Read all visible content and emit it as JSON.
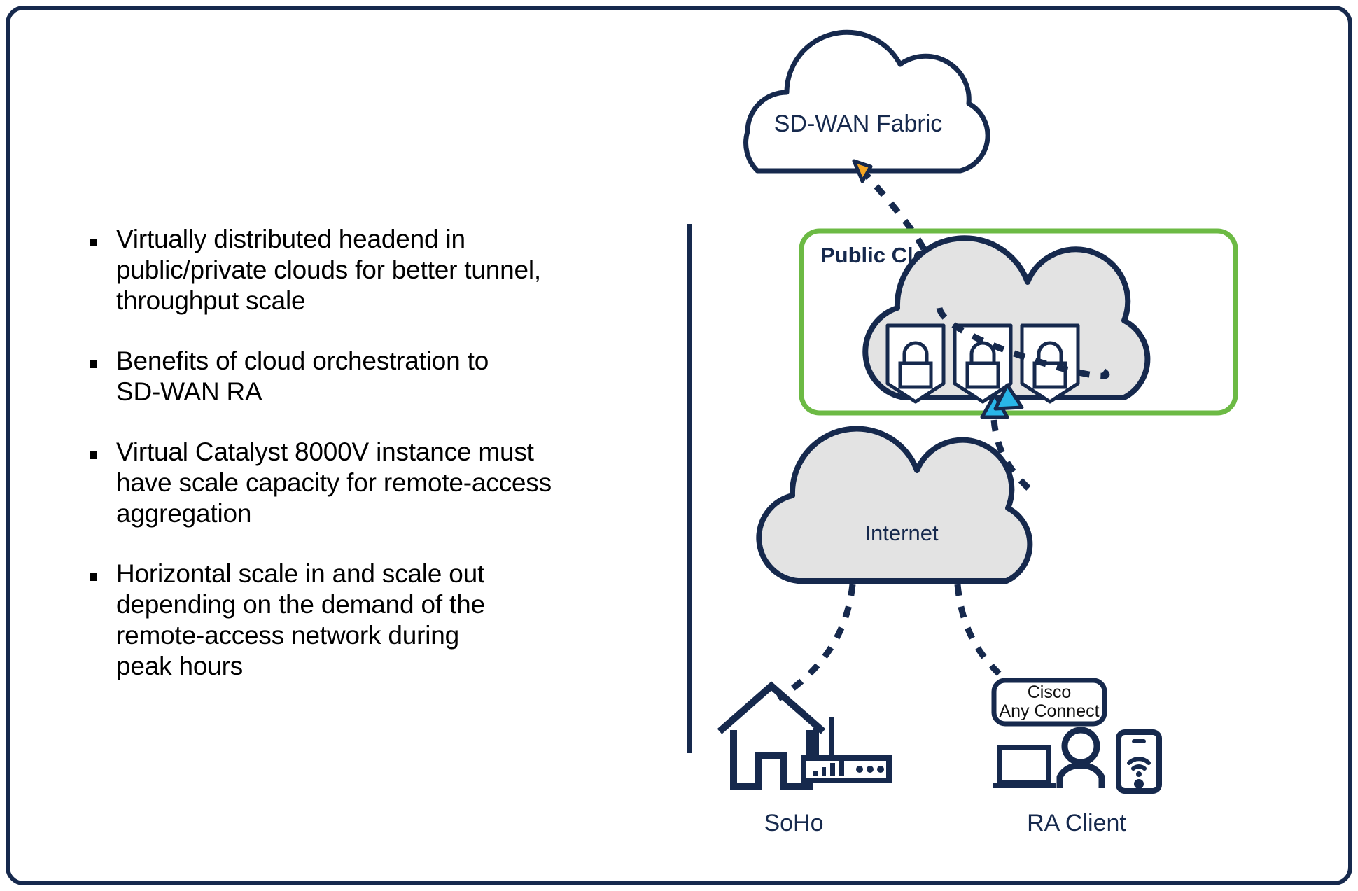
{
  "slide": {
    "border_color": "#16294d",
    "background": "#ffffff"
  },
  "bullets": [
    {
      "text": "Virtually distributed headend in\npublic/private clouds for better tunnel,\nthroughput scale"
    },
    {
      "text": "Benefits of cloud orchestration to\nSD-WAN RA"
    },
    {
      "text": "Virtual Catalyst 8000V instance must\nhave scale capacity for remote-access\naggregation"
    },
    {
      "text": "Horizontal scale in and scale out\ndepending on the demand of the\nremote-access network during\npeak hours"
    }
  ],
  "diagram": {
    "colors": {
      "navy": "#16294d",
      "green": "#6cba44",
      "grey_fill": "#e3e3e3",
      "orange": "#f5a623",
      "cyan": "#29b6e8"
    },
    "fabric_cloud": {
      "label": "SD-WAN Fabric"
    },
    "public_cloud_box": {
      "label": "Public Cloud"
    },
    "headend_cloud": {
      "locks": [
        "lock-shield-1",
        "lock-shield-2",
        "lock-shield-3"
      ]
    },
    "internet_cloud": {
      "label": "Internet"
    },
    "soho": {
      "label": "SoHo"
    },
    "ra_client": {
      "label": "RA Client"
    },
    "anyconnect_badge": {
      "line1": "Cisco",
      "line2": "Any Connect"
    },
    "connectors": [
      {
        "name": "headend-to-fabric",
        "style": "dashed",
        "arrow_color": "#f5a623"
      },
      {
        "name": "internet-to-headend",
        "style": "dashed",
        "arrow_color": "#29b6e8"
      },
      {
        "name": "soho-to-internet",
        "style": "dashed",
        "arrow_color": "none"
      },
      {
        "name": "raclient-to-internet",
        "style": "dashed",
        "arrow_color": "none"
      }
    ]
  }
}
